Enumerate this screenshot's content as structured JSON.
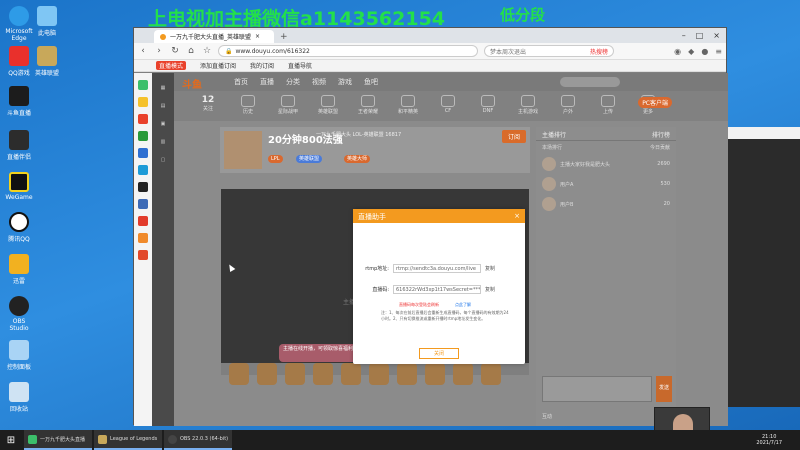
{
  "overlay": {
    "wechat_text": "上电视加主播微信a1143562154",
    "rank_text": "低分段"
  },
  "desktop_icons": [
    {
      "label": "Microsoft Edge"
    },
    {
      "label": "此电脑"
    },
    {
      "label": "QQ游戏"
    },
    {
      "label": "英雄联盟"
    },
    {
      "label": "斗鱼直播"
    },
    {
      "label": "直播伴侣"
    },
    {
      "label": "WeGame"
    },
    {
      "label": "腾讯QQ"
    },
    {
      "label": "迅雷"
    },
    {
      "label": "OBS Studio"
    },
    {
      "label": "控制面板"
    },
    {
      "label": "回收站"
    }
  ],
  "browser": {
    "tab_title": "一万九千肥大头直播_英雄联盟",
    "url": "www.douyu.com/616322",
    "search_placeholder": "梦本周次退出",
    "search_hot": "热搜榜",
    "bookmarks": [
      "直播模式",
      "添加直播订阅",
      "我的订阅",
      "直播导航"
    ]
  },
  "site": {
    "logo": "斗鱼",
    "nav": [
      "首页",
      "直播",
      "分类",
      "视频",
      "游戏",
      "鱼吧"
    ],
    "pc_client": "PC客户端",
    "categories": [
      {
        "label": "关注",
        "num": "12"
      },
      {
        "label": "历史",
        "num": ""
      },
      {
        "label": "星际战甲",
        "num": ""
      },
      {
        "label": "英雄联盟",
        "num": ""
      },
      {
        "label": "王者荣耀",
        "num": ""
      },
      {
        "label": "和平精英",
        "num": ""
      },
      {
        "label": "CF",
        "num": ""
      },
      {
        "label": "DNF",
        "num": ""
      },
      {
        "label": "主机游戏",
        "num": ""
      },
      {
        "label": "户外",
        "num": ""
      },
      {
        "label": "上传",
        "num": ""
      },
      {
        "label": "更多",
        "num": ""
      }
    ]
  },
  "room": {
    "title": "20分钟800法强",
    "meta": "一万九千肥大头   LOL-英雄联盟   16817",
    "subscribe": "订阅",
    "tags": [
      "LPL",
      "英雄联盟",
      "英雄大师"
    ]
  },
  "player": {
    "center_text": "主播正在休息"
  },
  "gift_banner": "主播在线开播，可领取惊喜福利",
  "chat": {
    "header_left": "主播排行",
    "header_right": "排行榜",
    "tab_left": "本场排行",
    "tab_right": "今日贡献",
    "ranks": [
      {
        "name": "主播大家好我是肥大头",
        "value": "2690"
      },
      {
        "name": "用户A",
        "value": "530"
      },
      {
        "name": "用户B",
        "value": "20"
      }
    ],
    "send": "发送",
    "footer": "互动"
  },
  "modal": {
    "title": "直播助手",
    "rtmp_label": "rtmp地址:",
    "rtmp_value": "rtmp://sendtc3a.douyu.com/live",
    "key_label": "直播码:",
    "key_value": "616322rWd3xp1t17wsSecret=********",
    "copy": "复制",
    "warn": "直播码每次登陆会刷新",
    "more": "点此了解",
    "notes": "注：1、每次在前后直播后会重新生成直播码，每个直播码的有效期为24小时。2、只有切换推流或重新开播时rtmp地址发生变化。",
    "close_button": "关闭"
  },
  "taskbar": {
    "tasks": [
      {
        "label": "一万九千肥大头直播"
      },
      {
        "label": "League of Legends"
      },
      {
        "label": "OBS 22.0.3 (64-bit)"
      }
    ],
    "time": "21:10",
    "date": "2021/7/17"
  }
}
